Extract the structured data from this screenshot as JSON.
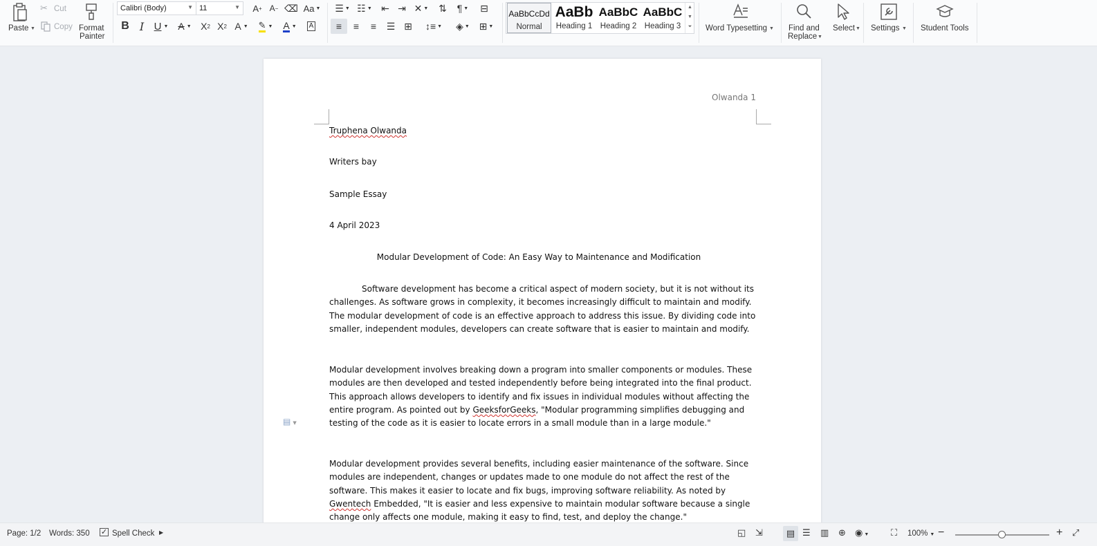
{
  "ribbon": {
    "clipboard": {
      "paste": "Paste",
      "cut": "Cut",
      "copy": "Copy",
      "format_painter_1": "Format",
      "format_painter_2": "Painter"
    },
    "font": {
      "name": "Calibri (Body)",
      "size": "11"
    },
    "styles": [
      {
        "preview": "AaBbCcDd",
        "name": "Normal"
      },
      {
        "preview": "AaBb",
        "name": "Heading 1"
      },
      {
        "preview": "AaBbC",
        "name": "Heading 2"
      },
      {
        "preview": "AaBbC",
        "name": "Heading 3"
      }
    ],
    "word_typesetting": "Word Typesetting",
    "find_replace_1": "Find and",
    "find_replace_2": "Replace",
    "select": "Select",
    "settings": "Settings",
    "student_tools": "Student Tools"
  },
  "document": {
    "header_text": "Olwanda 1",
    "author": "Truphena Olwanda",
    "institution": "Writers bay",
    "course": "Sample Essay",
    "date": "4 April 2023",
    "title": "Modular Development of Code: An Easy Way to Maintenance and Modification",
    "p1": [
      "Software development has become a critical aspect of modern society, but it is not without its",
      "challenges. As software grows in complexity, it becomes increasingly difficult to maintain and modify.",
      "The modular development of code is an effective approach to address this issue. By dividing code into",
      "smaller, independent modules, developers can create software that is easier to maintain and modify."
    ],
    "p2": [
      "Modular development involves breaking down a program into smaller components or modules. These",
      "modules are then developed and tested independently before being integrated into the final product.",
      "This approach allows developers to identify and fix issues in individual modules without affecting the",
      "entire program. As pointed out by ",
      "GeeksforGeeks",
      ", \"Modular programming simplifies debugging and",
      "testing of the code as it is easier to locate errors in a small module than in a large module.\""
    ],
    "p3": [
      "Modular development provides several benefits, including easier maintenance of the software. Since",
      "modules are independent, changes or updates made to one module do not affect the rest of the",
      "software. This makes it easier to locate and fix bugs, improving software reliability.  As noted by",
      "Gwentech",
      " Embedded, \"It is easier and less expensive to maintain modular software because a single",
      "change only affects one module, making it easy to find, test, and deploy the change.\""
    ]
  },
  "status": {
    "page": "Page: 1/2",
    "words": "Words: 350",
    "spell_check": "Spell Check",
    "zoom": "100%",
    "zoom_level": 0.5
  }
}
